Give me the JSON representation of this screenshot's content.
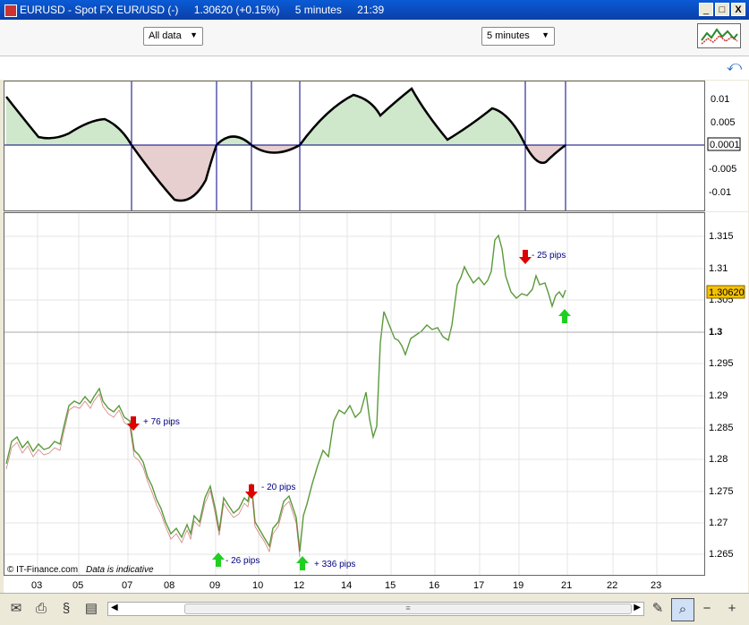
{
  "window": {
    "title": "EURUSD - Spot FX EUR/USD (-)",
    "price": "1.30620 (+0.15%)",
    "timeframe": "5 minutes",
    "time": "21:39",
    "min": "_",
    "max": "□",
    "close": "X"
  },
  "toolbar": {
    "range": "All data",
    "interval": "5 minutes"
  },
  "osc": {
    "ticks": [
      "0.01",
      "0.005",
      "0.0001",
      "-0.005",
      "-0.01"
    ]
  },
  "price": {
    "ticks": [
      "1.315",
      "1.31",
      "1.305",
      "1.3",
      "1.295",
      "1.29",
      "1.285",
      "1.28",
      "1.275",
      "1.27",
      "1.265"
    ],
    "last": "1.30620"
  },
  "xaxis": {
    "labels": [
      "03",
      "05",
      "07",
      "08",
      "09",
      "10",
      "12",
      "14",
      "15",
      "16",
      "17",
      "19",
      "21",
      "22",
      "23"
    ]
  },
  "annotations": {
    "a1": "+ 76 pips",
    "a2": "- 26 pips",
    "a3": "- 20 pips",
    "a4": "+ 336 pips",
    "a5": "- 25 pips"
  },
  "footer": {
    "source": "© IT-Finance.com",
    "note": "Data is indicative"
  },
  "colors": {
    "up": "#00c000",
    "down": "#dd0000",
    "accent": "#f5c200"
  }
}
